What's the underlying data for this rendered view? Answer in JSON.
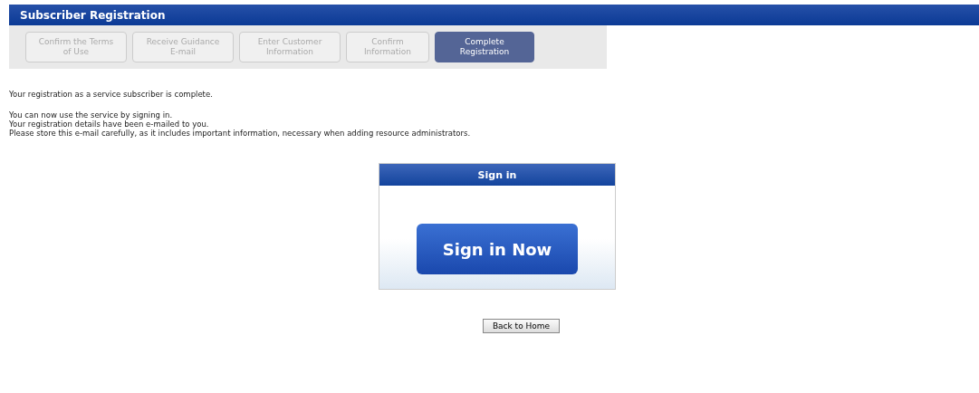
{
  "header": {
    "title": "Subscriber Registration"
  },
  "steps": [
    {
      "label": "Confirm the Terms of Use",
      "selected": false
    },
    {
      "label": "Receive Guidance E-mail",
      "selected": false
    },
    {
      "label": "Enter Customer Information",
      "selected": false
    },
    {
      "label": "Confirm Information",
      "selected": false
    },
    {
      "label": "Complete Registration",
      "selected": true
    }
  ],
  "messages": [
    "Your registration as a service subscriber is complete.",
    "You can now use the service by signing in.",
    "Your registration details have been e-mailed to you.",
    "Please store this e-mail carefully, as it includes important information, necessary when adding resource administrators."
  ],
  "sign_in_panel": {
    "title": "Sign in",
    "button": "Sign in Now"
  },
  "back_button": "Back to Home"
}
